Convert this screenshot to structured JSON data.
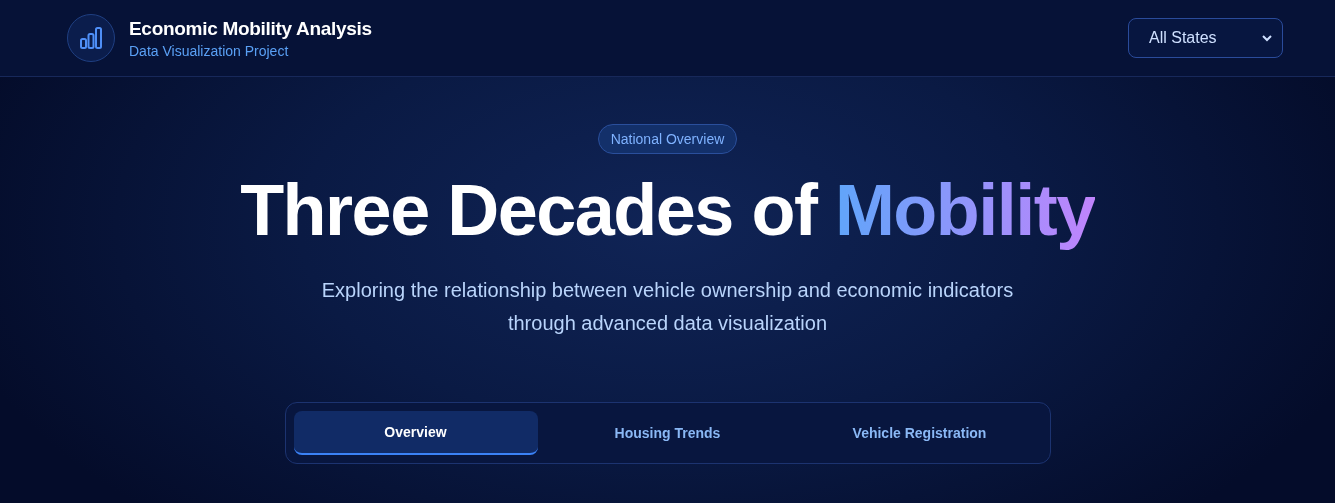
{
  "header": {
    "title": "Economic Mobility Analysis",
    "subtitle": "Data Visualization Project",
    "state_select": {
      "value": "All States"
    }
  },
  "hero": {
    "badge": "National Overview",
    "title": "Three Decades of",
    "title_highlight": "Mobility",
    "description": "Exploring the relationship between vehicle ownership and economic indicators through advanced data visualization"
  },
  "tabs": [
    {
      "label": "Overview",
      "selected": true
    },
    {
      "label": "Housing Trends",
      "selected": false
    },
    {
      "label": "Vehicle Registration",
      "selected": false
    }
  ]
}
